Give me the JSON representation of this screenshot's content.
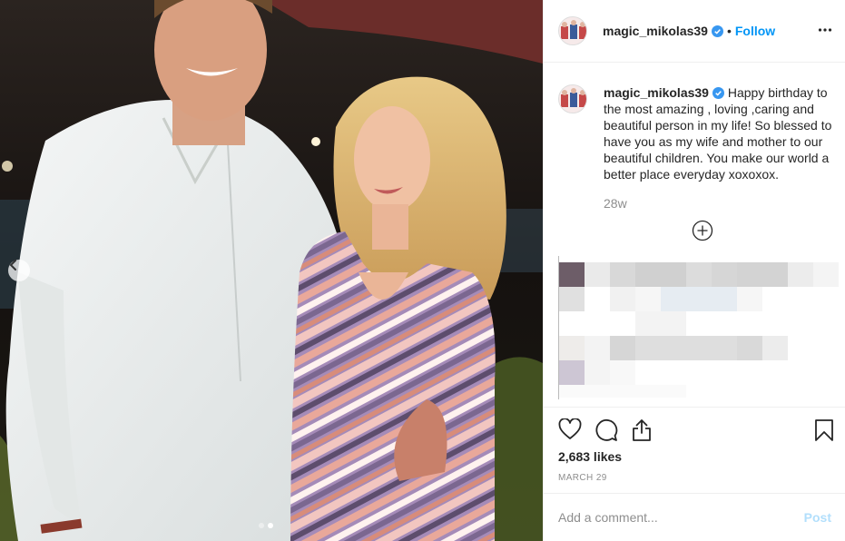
{
  "post": {
    "username": "magic_mikolas39",
    "follow_label": "Follow",
    "separator": "•",
    "caption": "Happy birthday to the most amazing , loving ,caring and beautiful person in my life! So blessed to have you as my wife and mother to our beautiful children. You make our world a better place everyday xoxoxox.",
    "time_ago": "28w",
    "likes": "2,683 likes",
    "date": "MARCH 29",
    "comment_placeholder": "Add a comment...",
    "post_label": "Post",
    "carousel": {
      "total": 2,
      "active_index": 1
    }
  },
  "icons": {
    "verified": "verified-badge-icon",
    "more": "more-options-icon",
    "load_more": "load-more-comments-icon",
    "like": "heart-icon",
    "comment": "comment-icon",
    "share": "share-icon",
    "save": "bookmark-icon",
    "prev": "chevron-left-icon"
  },
  "colors": {
    "link": "#0095f6",
    "verified": "#3897f0",
    "post_disabled": "#b2dffc",
    "muted": "#8e8e8e"
  }
}
